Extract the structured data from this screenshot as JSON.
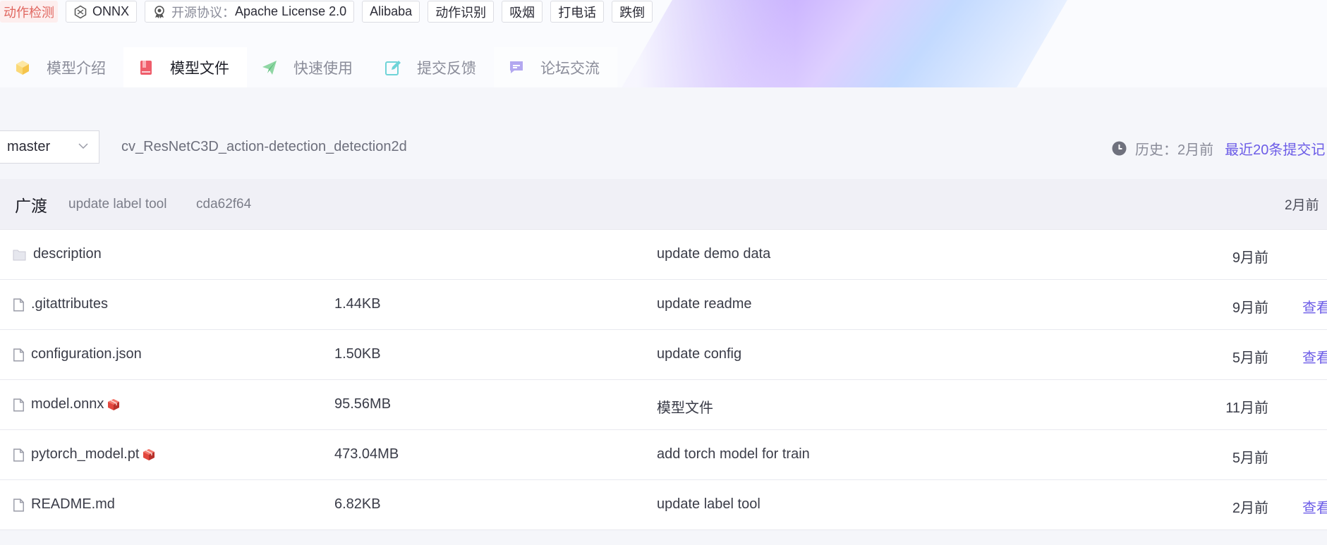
{
  "tags": {
    "task": "动作检测",
    "framework": "ONNX",
    "license_label": "开源协议",
    "license_value": "Apache License 2.0",
    "org": "Alibaba",
    "keywords": [
      "动作识别",
      "吸烟",
      "打电话",
      "跌倒"
    ]
  },
  "tabs": [
    {
      "label": "模型介绍",
      "icon": "cube-icon",
      "active": false
    },
    {
      "label": "模型文件",
      "icon": "book-icon",
      "active": true
    },
    {
      "label": "快速使用",
      "icon": "paper-plane-icon",
      "active": false
    },
    {
      "label": "提交反馈",
      "icon": "edit-icon",
      "active": false
    },
    {
      "label": "论坛交流",
      "icon": "chat-icon",
      "active": false
    }
  ],
  "repo": {
    "branch": "master",
    "name": "cv_ResNetC3D_action-detection_detection2d",
    "history_label": "历史：2月前",
    "recent_commits_link": "最近20条提交记"
  },
  "last_commit": {
    "author": "广渡",
    "message": "update label tool",
    "hash": "cda62f64",
    "time": "2月前"
  },
  "files": [
    {
      "name": "description",
      "type": "dir",
      "size": "",
      "message": "update demo data",
      "time": "9月前",
      "view": ""
    },
    {
      "name": ".gitattributes",
      "type": "file",
      "size": "1.44KB",
      "message": "update readme",
      "time": "9月前",
      "view": "查看"
    },
    {
      "name": "configuration.json",
      "type": "file",
      "size": "1.50KB",
      "message": "update config",
      "time": "5月前",
      "view": "查看"
    },
    {
      "name": "model.onnx",
      "type": "file",
      "lfs": true,
      "size": "95.56MB",
      "message": "模型文件",
      "time": "11月前",
      "view": ""
    },
    {
      "name": "pytorch_model.pt",
      "type": "file",
      "lfs": true,
      "size": "473.04MB",
      "message": "add torch model for train",
      "time": "5月前",
      "view": ""
    },
    {
      "name": "README.md",
      "type": "file",
      "size": "6.82KB",
      "message": "update label tool",
      "time": "2月前",
      "view": "查看"
    }
  ],
  "colors": {
    "accent": "#6c5ce7",
    "task_tag": "#e0665f"
  }
}
